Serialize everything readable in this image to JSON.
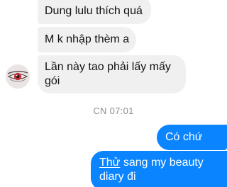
{
  "conversation": {
    "incoming": [
      {
        "text": "Dung lulu thích quá"
      },
      {
        "text": "M k nhập thèm a"
      },
      {
        "text": "Lần này tao phải lấy mấy gói"
      }
    ],
    "timestamp": "CN 07:01",
    "outgoing": [
      {
        "text": "Có chứ"
      },
      {
        "prefix": "Thử",
        "rest": " sang my beauty diary đi"
      }
    ]
  },
  "colors": {
    "incoming_bubble": "#f1f0f0",
    "outgoing_bubble": "#0a84ff",
    "timestamp_text": "#8a8d91"
  },
  "icons": {
    "avatar": "eye-avatar-icon"
  }
}
